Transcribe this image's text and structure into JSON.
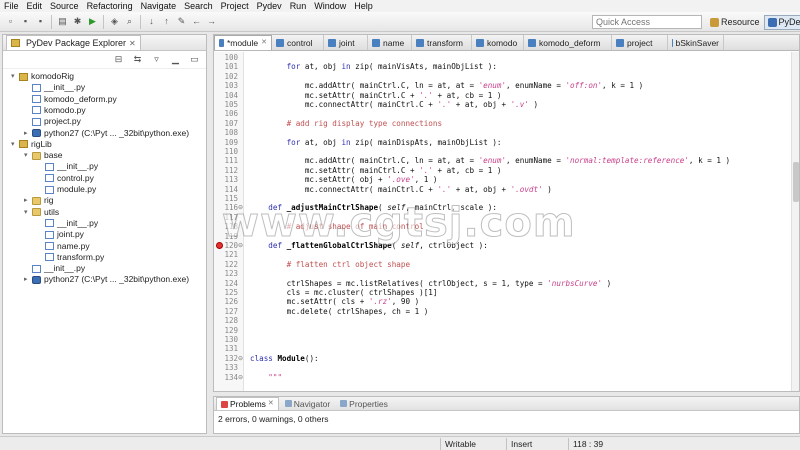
{
  "menu": [
    "File",
    "Edit",
    "Source",
    "Refactoring",
    "Navigate",
    "Search",
    "Project",
    "Pydev",
    "Run",
    "Window",
    "Help"
  ],
  "quick_access": {
    "placeholder": "Quick Access"
  },
  "perspectives": {
    "resource": "Resource",
    "pydev": "PyDev"
  },
  "explorer": {
    "title": "PyDev Package Explorer",
    "items": [
      {
        "label": "komodoRig",
        "type": "project",
        "arrow": "▾",
        "depth": 0
      },
      {
        "label": "__init__.py",
        "type": "pyfile",
        "arrow": "",
        "depth": 1
      },
      {
        "label": "komodo_deform.py",
        "type": "pyfile",
        "arrow": "",
        "depth": 1
      },
      {
        "label": "komodo.py",
        "type": "pyfile",
        "arrow": "",
        "depth": 1
      },
      {
        "label": "project.py",
        "type": "pyfile",
        "arrow": "",
        "depth": 1
      },
      {
        "label": "python27  (C:\\Pyt ... _32bit\\python.exe)",
        "type": "python",
        "arrow": "▸",
        "depth": 1
      },
      {
        "label": "rigLib",
        "type": "project",
        "arrow": "▾",
        "depth": 0
      },
      {
        "label": "base",
        "type": "folder",
        "arrow": "▾",
        "depth": 1
      },
      {
        "label": "__init__.py",
        "type": "pyfile",
        "arrow": "",
        "depth": 2
      },
      {
        "label": "control.py",
        "type": "pyfile",
        "arrow": "",
        "depth": 2
      },
      {
        "label": "module.py",
        "type": "pyfile",
        "arrow": "",
        "depth": 2
      },
      {
        "label": "rig",
        "type": "folder",
        "arrow": "▸",
        "depth": 1
      },
      {
        "label": "utils",
        "type": "folder",
        "arrow": "▾",
        "depth": 1
      },
      {
        "label": "__init__.py",
        "type": "pyfile",
        "arrow": "",
        "depth": 2
      },
      {
        "label": "joint.py",
        "type": "pyfile",
        "arrow": "",
        "depth": 2
      },
      {
        "label": "name.py",
        "type": "pyfile",
        "arrow": "",
        "depth": 2
      },
      {
        "label": "transform.py",
        "type": "pyfile",
        "arrow": "",
        "depth": 2
      },
      {
        "label": "__init__.py",
        "type": "pyfile",
        "arrow": "",
        "depth": 1
      },
      {
        "label": "python27  (C:\\Pyt ... _32bit\\python.exe)",
        "type": "python",
        "arrow": "▸",
        "depth": 1
      }
    ]
  },
  "editor": {
    "tabs": [
      "*module",
      "control",
      "joint",
      "name",
      "transform",
      "komodo",
      "komodo_deform",
      "project",
      "bSkinSaver"
    ],
    "active_tab": 0,
    "lines": [
      {
        "n": "100",
        "html": ""
      },
      {
        "n": "101",
        "html": "        <span class=\"kw\">for</span> at, obj <span class=\"kw\">in</span> zip( mainVisAts, mainObjList ):"
      },
      {
        "n": "102",
        "html": ""
      },
      {
        "n": "103",
        "html": "            mc.addAttr( mainCtrl.C, ln = at, at = <span class=\"str\">'enum'</span>, enumName = <span class=\"str\">'off:on'</span>, k = 1 )"
      },
      {
        "n": "104",
        "html": "            mc.setAttr( mainCtrl.C + <span class=\"str\">'.'</span> + at, cb = 1 )"
      },
      {
        "n": "105",
        "html": "            mc.connectAttr( mainCtrl.C + <span class=\"str\">'.'</span> + at, obj + <span class=\"str\">'.v'</span> )"
      },
      {
        "n": "106",
        "html": ""
      },
      {
        "n": "107",
        "html": "        <span class=\"com\"># add rig display type connections</span>"
      },
      {
        "n": "108",
        "html": ""
      },
      {
        "n": "109",
        "html": "        <span class=\"kw\">for</span> at, obj <span class=\"kw\">in</span> zip( mainDispAts, mainObjList ):"
      },
      {
        "n": "110",
        "html": ""
      },
      {
        "n": "111",
        "html": "            mc.addAttr( mainCtrl.C, ln = at, at = <span class=\"str\">'enum'</span>, enumName = <span class=\"str\">'normal:template:reference'</span>, k = 1 )"
      },
      {
        "n": "112",
        "html": "            mc.setAttr( mainCtrl.C + <span class=\"str\">'.'</span> + at, cb = 1 )"
      },
      {
        "n": "113",
        "html": "            mc.setAttr( obj + <span class=\"str\">'.ove'</span>, 1 )"
      },
      {
        "n": "114",
        "html": "            mc.connectAttr( mainCtrl.C + <span class=\"str\">'.'</span> + at, obj + <span class=\"str\">'.ovdt'</span> )"
      },
      {
        "n": "115",
        "html": ""
      },
      {
        "n": "116",
        "html": "    <span class=\"kw\">def</span> <span class=\"fn\">_adjustMainCtrlShape</span>( <i>self</i>, mainCtrl, scale ):",
        "fold": "⊖"
      },
      {
        "n": "117",
        "html": ""
      },
      {
        "n": "118",
        "html": "        <span class=\"com\"># adjust shape of main control</span>"
      },
      {
        "n": "119",
        "html": ""
      },
      {
        "n": "120",
        "html": "    <span class=\"kw\">def</span> <span class=\"fn\">_flattenGlobalCtrlShape</span>( <i>self</i>, ctrlObject ):",
        "fold": "⊖",
        "error": true
      },
      {
        "n": "121",
        "html": ""
      },
      {
        "n": "122",
        "html": "        <span class=\"com\"># flatten ctrl object shape</span>"
      },
      {
        "n": "123",
        "html": ""
      },
      {
        "n": "124",
        "html": "        ctrlShapes = mc.listRelatives( ctrlObject, s = 1, type = <span class=\"str\">'nurbsCurve'</span> )"
      },
      {
        "n": "125",
        "html": "        cls = mc.cluster( ctrlShapes )[1]"
      },
      {
        "n": "126",
        "html": "        mc.setAttr( cls + <span class=\"str\">'.rz'</span>, 90 )"
      },
      {
        "n": "127",
        "html": "        mc.delete( ctrlShapes, ch = 1 )"
      },
      {
        "n": "128",
        "html": ""
      },
      {
        "n": "129",
        "html": ""
      },
      {
        "n": "130",
        "html": ""
      },
      {
        "n": "131",
        "html": ""
      },
      {
        "n": "132",
        "html": "<span class=\"kw\">class</span> <span class=\"fn\">Module</span>():",
        "fold": "⊖"
      },
      {
        "n": "133",
        "html": ""
      },
      {
        "n": "134",
        "html": "    <span class=\"str\">\"\"\"</span>",
        "fold": "⊖"
      }
    ]
  },
  "watermark": "www.cgtsj.com",
  "problems": {
    "tabs": [
      "Problems",
      "Navigator",
      "Properties"
    ],
    "summary": "2 errors, 0 warnings, 0 others"
  },
  "status": {
    "writable": "Writable",
    "insert": "Insert",
    "position": "118 : 39"
  }
}
